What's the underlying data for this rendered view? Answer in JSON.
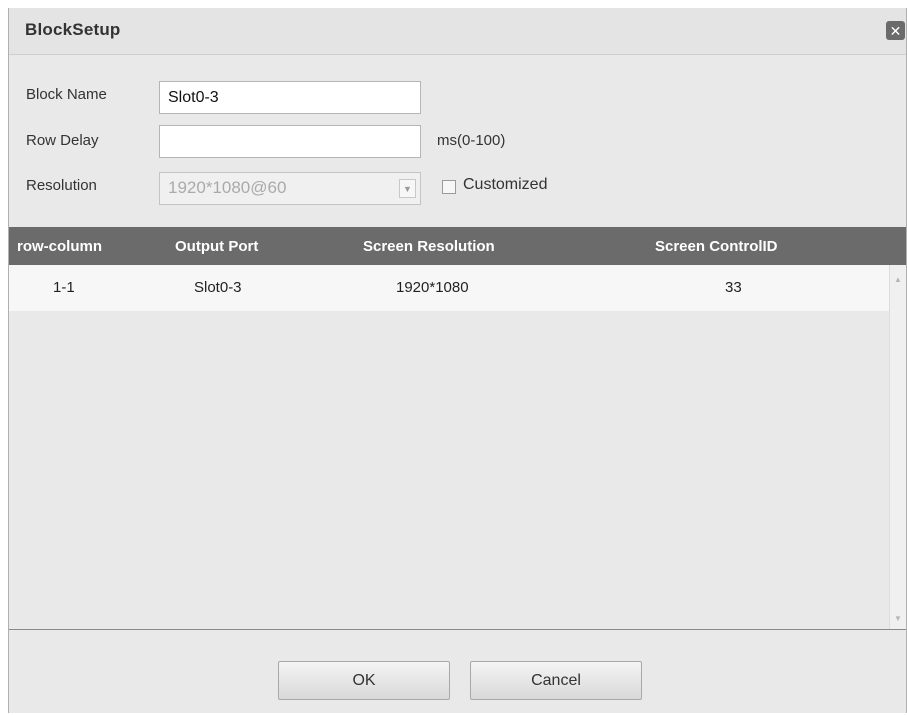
{
  "dialog": {
    "title": "BlockSetup",
    "close_glyph": "✕"
  },
  "form": {
    "block_name_label": "Block Name",
    "block_name_value": "Slot0-3",
    "row_delay_label": "Row Delay",
    "row_delay_value": "",
    "row_delay_unit": "ms(0-100)",
    "resolution_label": "Resolution",
    "resolution_value": "1920*1080@60",
    "resolution_disabled": true,
    "customized_label": "Customized",
    "customized_checked": false
  },
  "table": {
    "headers": [
      "row-column",
      "Output Port",
      "Screen Resolution",
      "Screen ControlID"
    ],
    "rows": [
      [
        "1-1",
        "Slot0-3",
        "1920*1080",
        "33"
      ]
    ]
  },
  "buttons": {
    "ok": "OK",
    "cancel": "Cancel"
  },
  "colors": {
    "header_bg": "#6b6b6b",
    "dialog_bg": "#e9e9e9",
    "row_bg": "#f7f7f7"
  }
}
